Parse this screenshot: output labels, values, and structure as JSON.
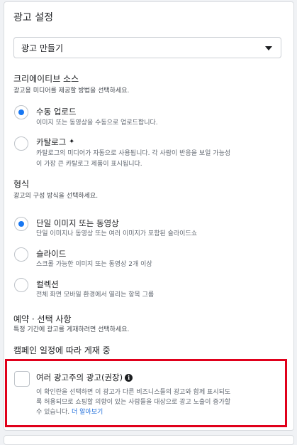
{
  "section": {
    "title": "광고 설정",
    "select_value": "광고 만들기"
  },
  "creative_source": {
    "heading": "크리에이티브 소스",
    "description": "광고용 미디어를 제공할 방법을 선택하세요.",
    "options": [
      {
        "label": "수동 업로드",
        "desc": "이미지 또는 동영상을 수동으로 업로드합니다.",
        "selected": true
      },
      {
        "label": "카탈로그",
        "desc_line1": "카탈로그의 미디어가 자동으로 사용됩니다. 각 사람이 반응을 보일 가능성",
        "desc_line2": "이 가장 큰 카탈로그 제품이 표시됩니다.",
        "selected": false,
        "sparkle": "✦"
      }
    ]
  },
  "format": {
    "heading": "형식",
    "description": "광고의 구성 방식을 선택하세요.",
    "options": [
      {
        "label": "단일 이미지 또는 동영상",
        "desc": "단일 이미지나 동영상 또는 여러 이미지가 포함된 슬라이드쇼",
        "selected": true
      },
      {
        "label": "슬라이드",
        "desc": "스크롤 가능한 이미지 또는 동영상 2개 이상",
        "selected": false
      },
      {
        "label": "컬렉션",
        "desc": "전체 화면 모바일 환경에서 열리는 항목 그룹",
        "selected": false
      }
    ]
  },
  "reservation": {
    "heading": "예약 · 선택 사항",
    "description": "특정 기간에 광고를 게재하려면 선택하세요."
  },
  "schedule": {
    "label": "캠페인 일정에 따라 게재 중"
  },
  "multi_advertiser": {
    "label": "여러 광고주의 광고(권장)",
    "info_icon": "i",
    "desc_line1": "이 확인란을 선택하면 이 광고가 다른 비즈니스들의 광고와 함께 표시되도",
    "desc_line2": "록 허용되므로 쇼핑할 의향이 있는 사람들을 대상으로 광고 노출이 증가할",
    "desc_line3": "수 있습니다.",
    "link": "더 알아보기",
    "checked": false
  },
  "colors": {
    "accent": "#1877f2",
    "highlight": "#e0001b",
    "link": "#216fdb"
  }
}
